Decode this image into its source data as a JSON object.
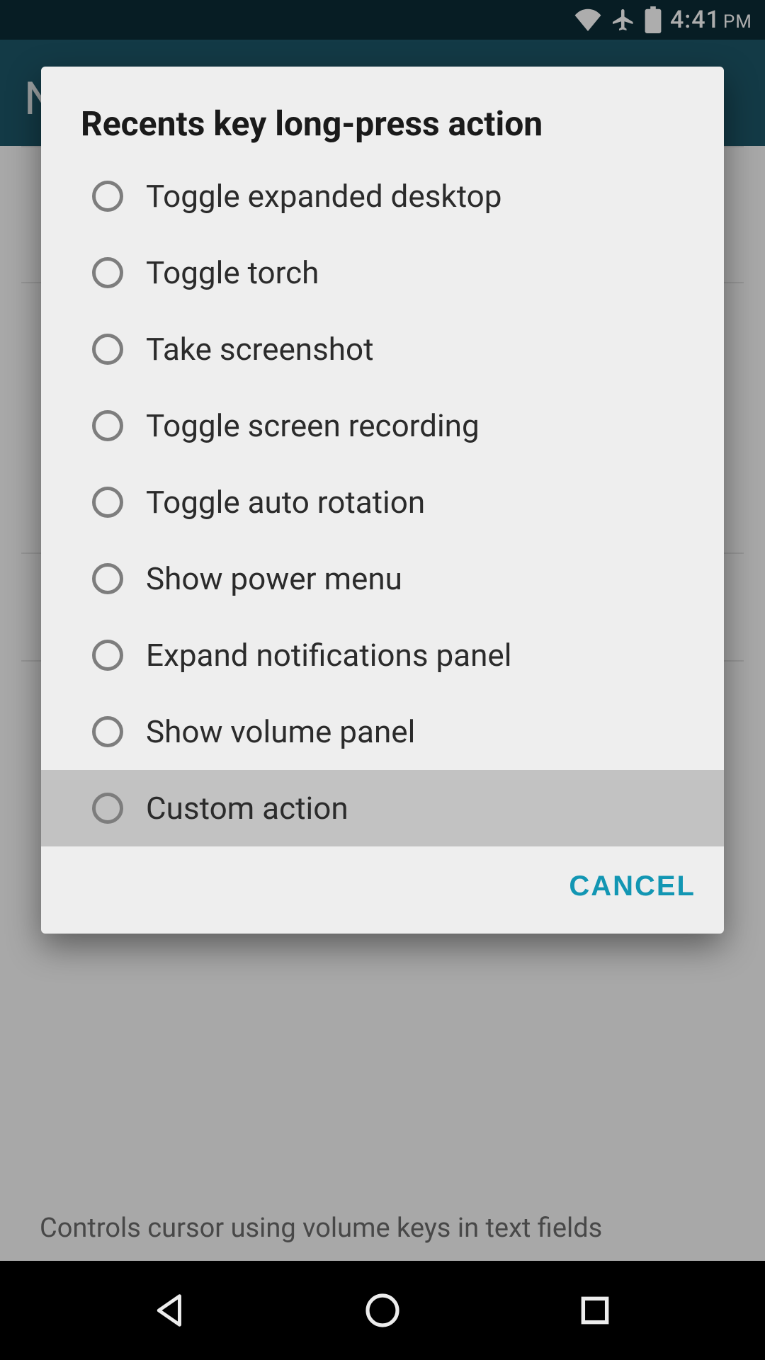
{
  "status": {
    "time": "4:41",
    "ampm": "PM",
    "icons": {
      "wifi": "wifi-icon",
      "airplane": "airplane-icon",
      "battery": "battery-icon"
    }
  },
  "header": {
    "title_letter": "N"
  },
  "background": {
    "hint": "Controls cursor using volume keys in text fields"
  },
  "dialog": {
    "title": "Recents key long-press action",
    "options": [
      {
        "label": "Toggle expanded desktop",
        "highlight": false
      },
      {
        "label": "Toggle torch",
        "highlight": false
      },
      {
        "label": "Take screenshot",
        "highlight": false
      },
      {
        "label": "Toggle screen recording",
        "highlight": false
      },
      {
        "label": "Toggle auto rotation",
        "highlight": false
      },
      {
        "label": "Show power menu",
        "highlight": false
      },
      {
        "label": "Expand notifications panel",
        "highlight": false
      },
      {
        "label": "Show volume panel",
        "highlight": false
      },
      {
        "label": "Custom action",
        "highlight": true
      }
    ],
    "cancel": "CANCEL"
  }
}
